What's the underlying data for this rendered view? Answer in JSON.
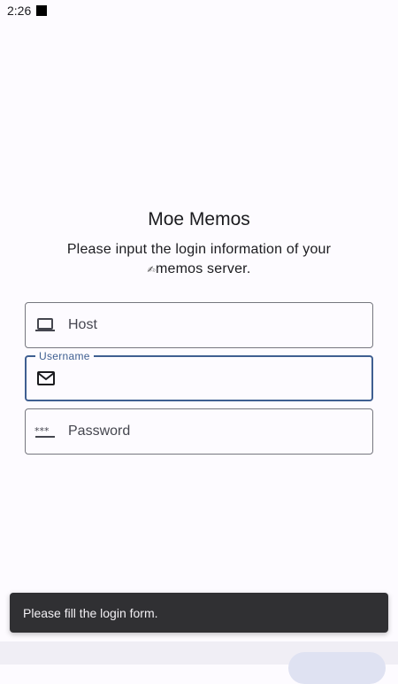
{
  "status_bar": {
    "time": "2:26"
  },
  "header": {
    "title": "Moe Memos",
    "subtitle_line1": "Please input the login information of your",
    "subtitle_line2": "memos server.",
    "subtitle_icon": "pencil-icon"
  },
  "form": {
    "host": {
      "placeholder": "Host",
      "icon": "laptop-icon",
      "value": ""
    },
    "username": {
      "label": "Username",
      "icon": "mail-icon",
      "value": ""
    },
    "password": {
      "placeholder": "Password",
      "icon": "password-dots-icon",
      "value": ""
    }
  },
  "snackbar": {
    "message": "Please fill the login form."
  },
  "colors": {
    "accent": "#3f5f91",
    "background": "#fdfbff",
    "snackbar": "#303033",
    "outline": "#76777f"
  }
}
